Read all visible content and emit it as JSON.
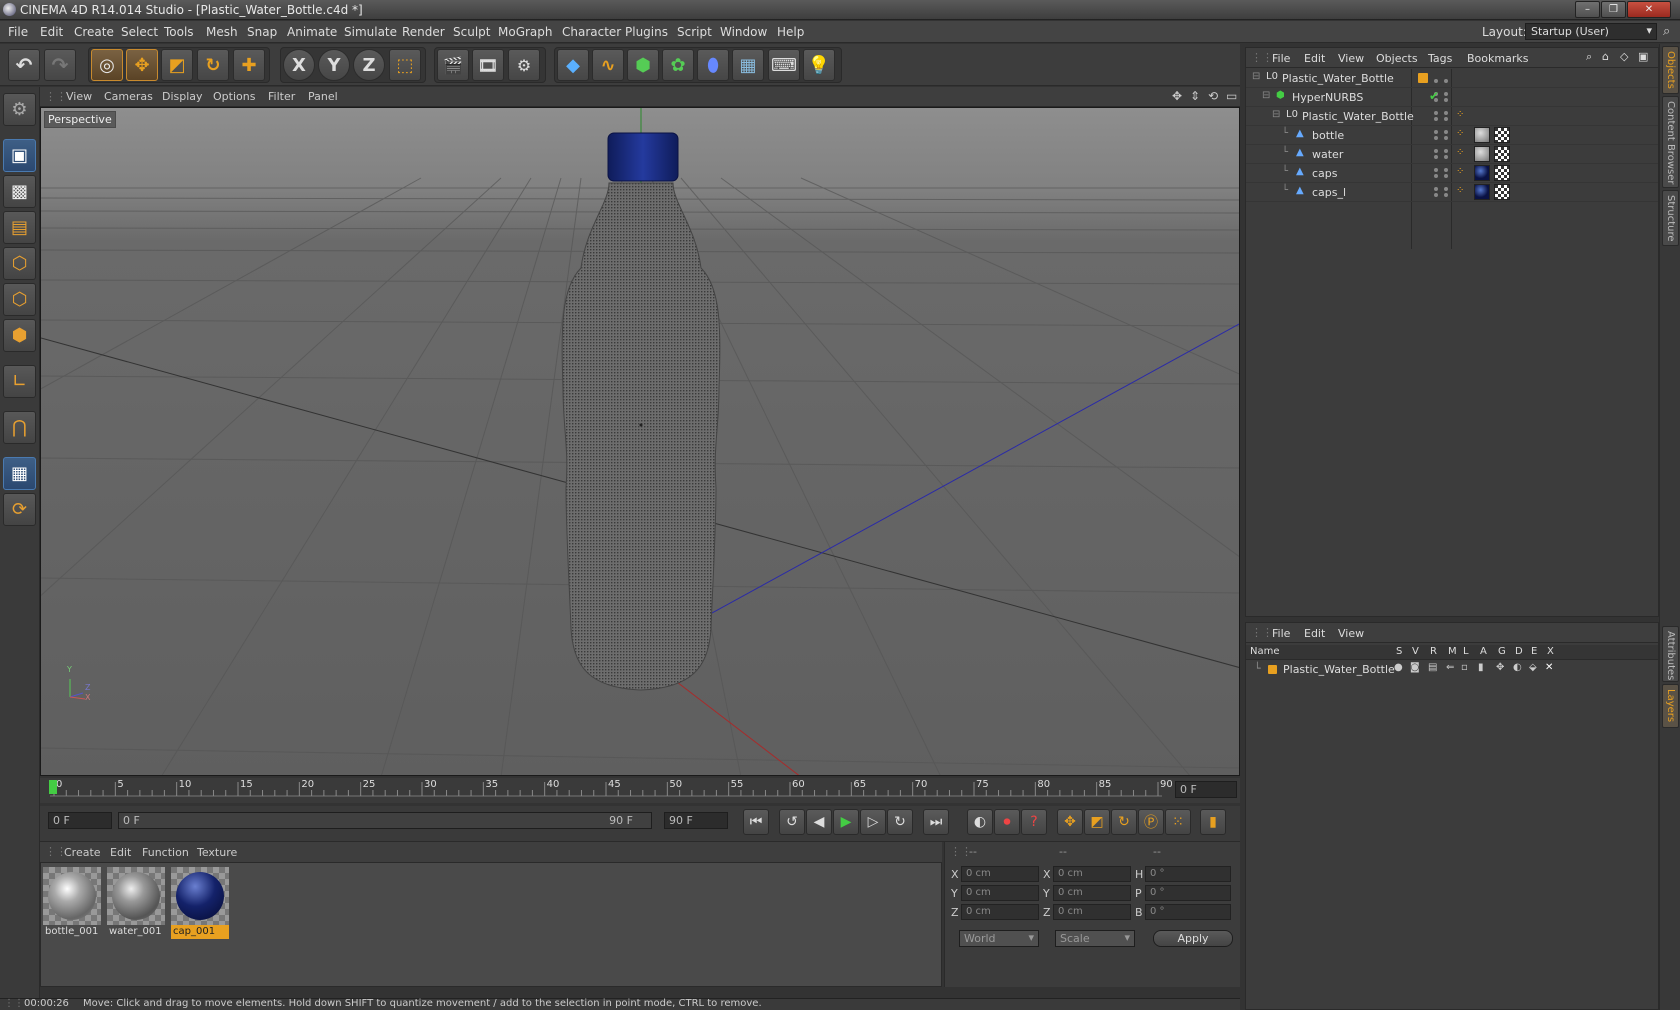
{
  "window": {
    "title": "CINEMA 4D R14.014 Studio - [Plastic_Water_Bottle.c4d *]",
    "buttons": [
      "–",
      "❐",
      "✕"
    ]
  },
  "menubar": {
    "items": [
      "File",
      "Edit",
      "Create",
      "Select",
      "Tools",
      "Mesh",
      "Snap",
      "Animate",
      "Simulate",
      "Render",
      "Sculpt",
      "MoGraph",
      "Character",
      "Plugins",
      "Script",
      "Window",
      "Help"
    ],
    "layout_label": "Layout:",
    "layout_value": "Startup (User)"
  },
  "toolbar": {
    "axis_x": "X",
    "axis_y": "Y",
    "axis_z": "Z"
  },
  "viewport": {
    "menu": [
      "View",
      "Cameras",
      "Display",
      "Options",
      "Filter",
      "Panel"
    ],
    "camera_label": "Perspective",
    "axis_y": "Y",
    "axis_z": "Z",
    "axis_x": "X"
  },
  "timeline": {
    "ticks": [
      "0",
      "5",
      "10",
      "15",
      "20",
      "25",
      "30",
      "35",
      "40",
      "45",
      "50",
      "55",
      "60",
      "65",
      "70",
      "75",
      "80",
      "85",
      "90"
    ],
    "current_frame": "0 F",
    "start_field": "0 F",
    "range_start": "0 F",
    "range_end": "90 F",
    "end_field": "90 F"
  },
  "materials": {
    "menu": [
      "Create",
      "Edit",
      "Function",
      "Texture"
    ],
    "items": [
      {
        "name": "bottle_001"
      },
      {
        "name": "water_001"
      },
      {
        "name": "cap_001"
      }
    ]
  },
  "coordinates": {
    "headers": [
      "--",
      "--",
      "--"
    ],
    "rows": [
      {
        "l1": "X",
        "v1": "0 cm",
        "l2": "X",
        "v2": "0 cm",
        "l3": "H",
        "v3": "0 °"
      },
      {
        "l1": "Y",
        "v1": "0 cm",
        "l2": "Y",
        "v2": "0 cm",
        "l3": "P",
        "v3": "0 °"
      },
      {
        "l1": "Z",
        "v1": "0 cm",
        "l2": "Z",
        "v2": "0 cm",
        "l3": "B",
        "v3": "0 °"
      }
    ],
    "mode": "World",
    "scale": "Scale",
    "apply": "Apply"
  },
  "status": {
    "time": "00:00:26",
    "message": "Move: Click and drag to move elements. Hold down SHIFT to quantize movement / add to the selection in point mode, CTRL to remove."
  },
  "objects": {
    "menu": [
      "File",
      "Edit",
      "View",
      "Objects",
      "Tags",
      "Bookmarks"
    ],
    "tree": [
      {
        "name": "Plastic_Water_Bottle"
      },
      {
        "name": "HyperNURBS"
      },
      {
        "name": "Plastic_Water_Bottle"
      },
      {
        "name": "bottle"
      },
      {
        "name": "water"
      },
      {
        "name": "caps"
      },
      {
        "name": "caps_l"
      }
    ]
  },
  "layers": {
    "menu": [
      "File",
      "Edit",
      "View"
    ],
    "columns": [
      "Name",
      "S",
      "V",
      "R",
      "M",
      "L",
      "A",
      "G",
      "D",
      "E",
      "X"
    ],
    "rows": [
      {
        "name": "Plastic_Water_Bottle"
      }
    ]
  },
  "side_tabs": [
    "Objects",
    "Content Browser",
    "Structure",
    "Attributes",
    "Layers"
  ],
  "colors": {
    "accent": "#e8a020",
    "selection_blue": "#2b4870",
    "background": "#333333"
  }
}
